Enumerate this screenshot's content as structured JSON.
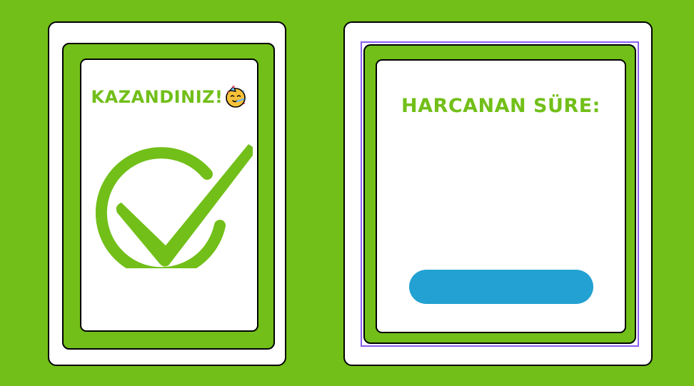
{
  "win_card": {
    "title": "KAZANDINIZ!",
    "icon": "party-face-icon",
    "badge_icon": "check-circle-icon"
  },
  "time_card": {
    "title": "HARCANAN SÜRE:",
    "value": "",
    "button_label": ""
  },
  "colors": {
    "background": "#72bf19",
    "accent_green": "#72bf19",
    "button_blue": "#22a1d2",
    "selection": "#8a5cf0"
  }
}
